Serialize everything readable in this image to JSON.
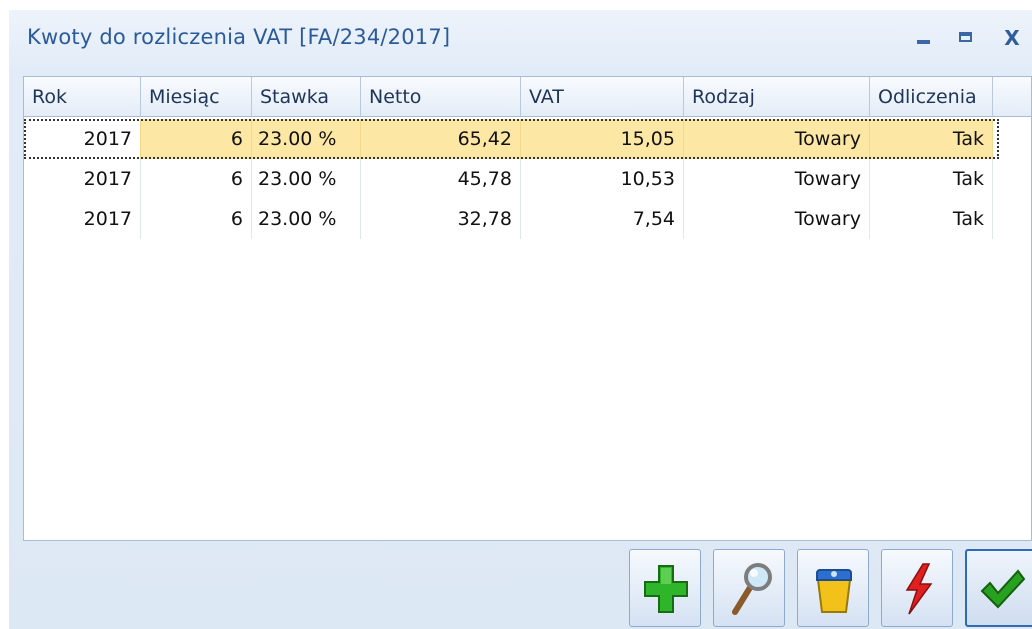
{
  "window": {
    "title": "Kwoty do rozliczenia VAT [FA/234/2017]",
    "controls": {
      "minimize": "–",
      "maximize": "▭",
      "close": "X"
    }
  },
  "table": {
    "columns": [
      "Rok",
      "Miesiąc",
      "Stawka",
      "Netto",
      "VAT",
      "Rodzaj",
      "Odliczenia"
    ],
    "rows": [
      [
        "2017",
        "6",
        "23.00 %",
        "65,42",
        "15,05",
        "Towary",
        "Tak"
      ],
      [
        "2017",
        "6",
        "23.00 %",
        "45,78",
        "10,53",
        "Towary",
        "Tak"
      ],
      [
        "2017",
        "6",
        "23.00 %",
        "32,78",
        "7,54",
        "Towary",
        "Tak"
      ]
    ],
    "selected_row": 0
  },
  "toolbar": {
    "buttons": [
      {
        "icon": "plus-icon"
      },
      {
        "icon": "magnifier-icon"
      },
      {
        "icon": "trash-bin-icon"
      },
      {
        "icon": "lightning-icon"
      },
      {
        "icon": "checkmark-icon"
      }
    ]
  },
  "colors": {
    "selected_row": "#fde7a4",
    "title_text": "#2b5a9c",
    "window_bg": "#dde8f5"
  }
}
